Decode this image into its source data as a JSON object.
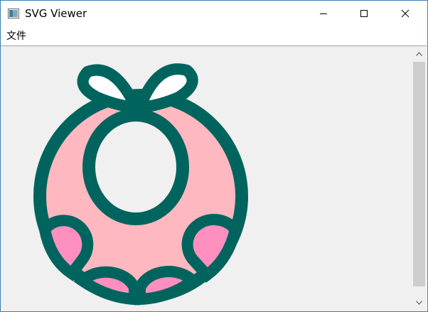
{
  "window": {
    "title": "SVG Viewer",
    "icon": "app-window-icon",
    "controls": [
      "minimize-icon",
      "maximize-icon",
      "close-icon"
    ]
  },
  "menu": {
    "items": [
      {
        "label": "文件"
      }
    ]
  },
  "scrollbar": {
    "position": 0,
    "visible_fraction": 0.87
  },
  "drawing": {
    "description_icon": "baby-bib-icon",
    "colors": {
      "outline": "#00645e",
      "fill_light": "#ffb8c0",
      "fill_accent": "#ff8fbe",
      "background": "#f0f0f0",
      "ribbon_fill": "#ffffff"
    }
  }
}
